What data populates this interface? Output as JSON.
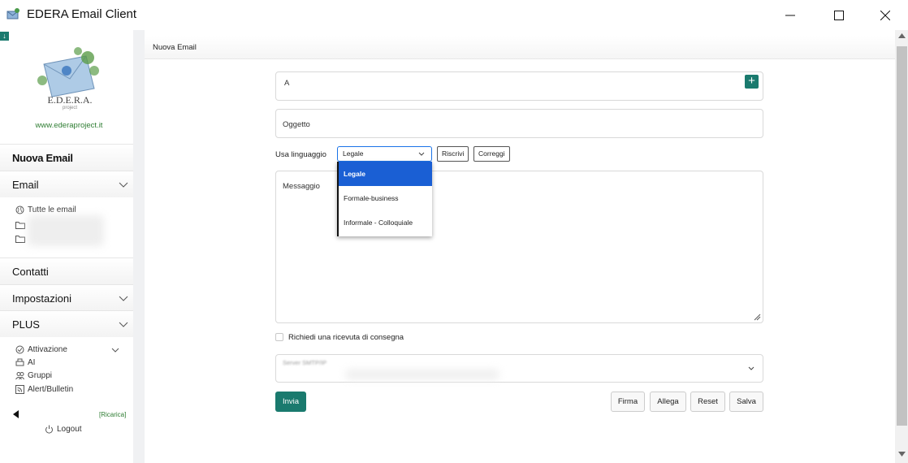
{
  "window": {
    "title": "EDERA Email Client"
  },
  "sidebar": {
    "logo_text": "E.D.E.R.A. project",
    "logo_link": "www.ederaproject.it",
    "nuova_email": "Nuova Email",
    "email_section": "Email",
    "tutte_le_email": "Tutte le email",
    "contatti": "Contatti",
    "impostazioni": "Impostazioni",
    "plus": "PLUS",
    "plus_items": [
      "Attivazione",
      "AI",
      "Gruppi",
      "Alert/Bulletin"
    ],
    "ricarica": "[Ricarica]",
    "logout": "Logout"
  },
  "main": {
    "header": "Nuova Email",
    "to_placeholder": "A",
    "subject_placeholder": "Oggetto",
    "language_label": "Usa linguaggio",
    "language_selected": "Legale",
    "language_options": [
      "Legale",
      "Formale-business",
      "Informale - Colloquiale"
    ],
    "rewrite_button": "Riscrivi",
    "correct_button": "Correggi",
    "message_placeholder": "Messaggio",
    "receipt_label": "Richiedi una ricevuta di consegna",
    "smtp_label": "Server SMTP/IP",
    "send_button": "Invia",
    "signature_button": "Firma",
    "attach_button": "Allega",
    "reset_button": "Reset",
    "save_button": "Salva"
  },
  "colors": {
    "accent": "#1a7a6e",
    "selected_option": "#1a5fd4"
  }
}
